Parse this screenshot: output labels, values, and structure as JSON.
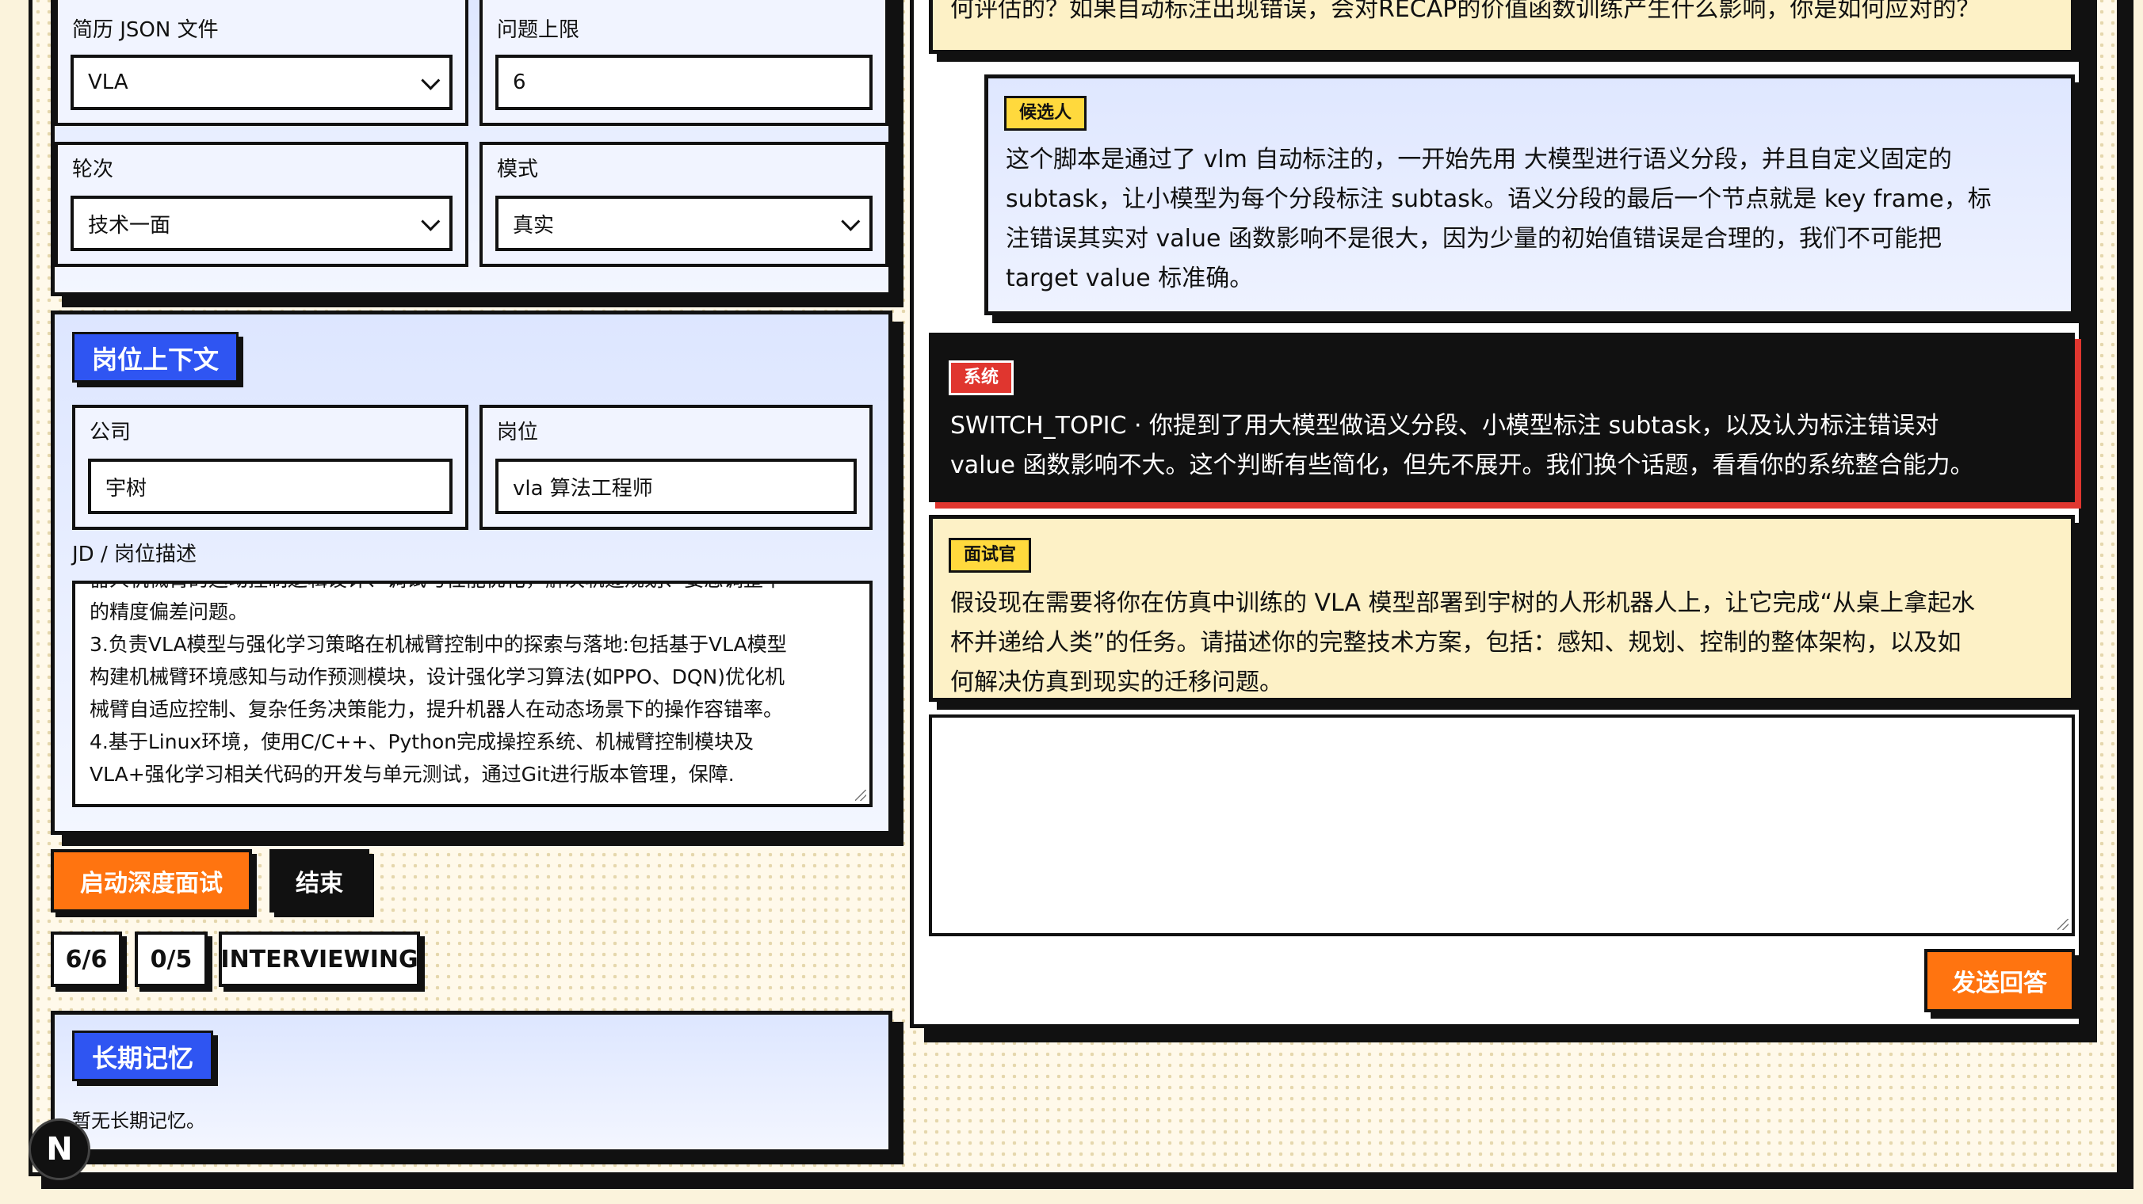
{
  "config": {
    "resume_label": "简历 JSON 文件",
    "resume_value": "VLA",
    "limit_label": "问题上限",
    "limit_value": "6",
    "round_label": "轮次",
    "round_value": "技术一面",
    "mode_label": "模式",
    "mode_value": "真实"
  },
  "job": {
    "section_title": "岗位上下文",
    "company_label": "公司",
    "company_value": "宇树",
    "position_label": "岗位",
    "position_value": "vla 算法工程师",
    "jd_label": "JD / 岗位描述",
    "jd_lines": [
      "器人机械臂的运动控制逻辑设计、调试与性能优化，解决轨迹规划、姿态调整中",
      "的精度偏差问题。",
      "3.负责VLA模型与强化学习策略在机械臂控制中的探索与落地:包括基于VLA模型",
      "构建机械臂环境感知与动作预测模块，设计强化学习算法(如PPO、DQN)优化机",
      "械臂自适应控制、复杂任务决策能力，提升机器人在动态场景下的操作容错率。",
      "4.基于Linux环境，使用C/C++、Python完成操控系统、机械臂控制模块及",
      "VLA+强化学习相关代码的开发与单元测试，通过Git进行版本管理，保障."
    ]
  },
  "actions": {
    "start_label": "启动深度面试",
    "end_label": "结束"
  },
  "status": {
    "questions": "6/6",
    "score": "0/5",
    "state": "INTERVIEWING"
  },
  "memory": {
    "section_title": "长期记忆",
    "empty_text": "暂无长期记忆。"
  },
  "chat": {
    "messages": [
      {
        "role": "",
        "lines": [
          "何评估的？如果自动标注出现错误，会对RECAP的价值函数训练产生什么影响，你是如何应对的？"
        ]
      },
      {
        "role": "候选人",
        "lines": [
          "这个脚本是通过了 vlm 自动标注的，一开始先用 大模型进行语义分段，并且自定义固定的",
          "subtask，让小模型为每个分段标注 subtask。语义分段的最后一个节点就是 key frame，标",
          "注错误其实对 value 函数影响不是很大，因为少量的初始值错误是合理的，我们不可能把",
          "target value 标准确。"
        ]
      },
      {
        "role": "系统",
        "lines": [
          "SWITCH_TOPIC · 你提到了用大模型做语义分段、小模型标注 subtask，以及认为标注错误对",
          "value 函数影响不大。这个判断有些简化，但先不展开。我们换个话题，看看你的系统整合能力。"
        ]
      },
      {
        "role": "面试官",
        "lines": [
          "假设现在需要将你在仿真中训练的 VLA 模型部署到宇树的人形机器人上，让它完成“从桌上拿起水",
          "杯并递给人类”的任务。请描述你的完整技术方案，包括：感知、规划、控制的整体架构，以及如",
          "何解决仿真到现实的迁移问题。"
        ]
      }
    ],
    "answer_value": "",
    "send_label": "发送回答"
  },
  "dev": {
    "badge_letter": "N"
  },
  "colors": {
    "accent_orange": "#ff7410",
    "accent_blue": "#2f55f2",
    "system_red": "#e0362f",
    "role_yellow": "#ffd93d",
    "page_bg": "#fbf3dc"
  }
}
